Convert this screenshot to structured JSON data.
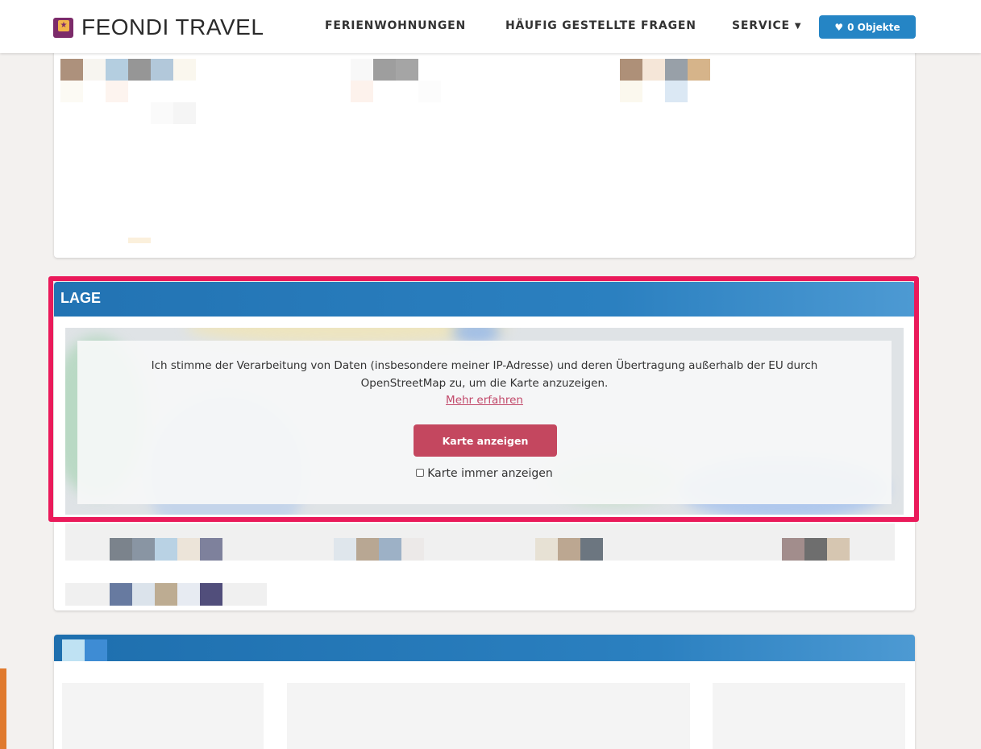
{
  "header": {
    "brand": "FEONDI TRAVEL",
    "nav": {
      "holiday_homes": "FERIENWOHNUNGEN",
      "faq": "HÄUFIG GESTELLTE FRAGEN",
      "service": "SERVICE"
    },
    "wishlist_label": "0 Objekte",
    "icons": {
      "logo": "feondi-logo-icon",
      "service_caret": "caret-down-icon",
      "wishlist": "heart-icon"
    }
  },
  "location_section": {
    "title": "LAGE",
    "consent_text": "Ich stimme der Verarbeitung von Daten (insbesondere meiner IP-Adresse) und deren Übertragung außerhalb der EU durch OpenStreetMap zu, um die Karte anzuzeigen.",
    "learn_more": "Mehr erfahren",
    "show_map_button": "Karte anzeigen",
    "always_show_label": "Karte immer anzeigen",
    "always_show_checked": false
  },
  "colors": {
    "brand_blue": "#2585c5",
    "section_header": "#2273b3",
    "map_button": "#c4475f",
    "highlight": "#ea1a5a",
    "link": "#c24a6b"
  }
}
